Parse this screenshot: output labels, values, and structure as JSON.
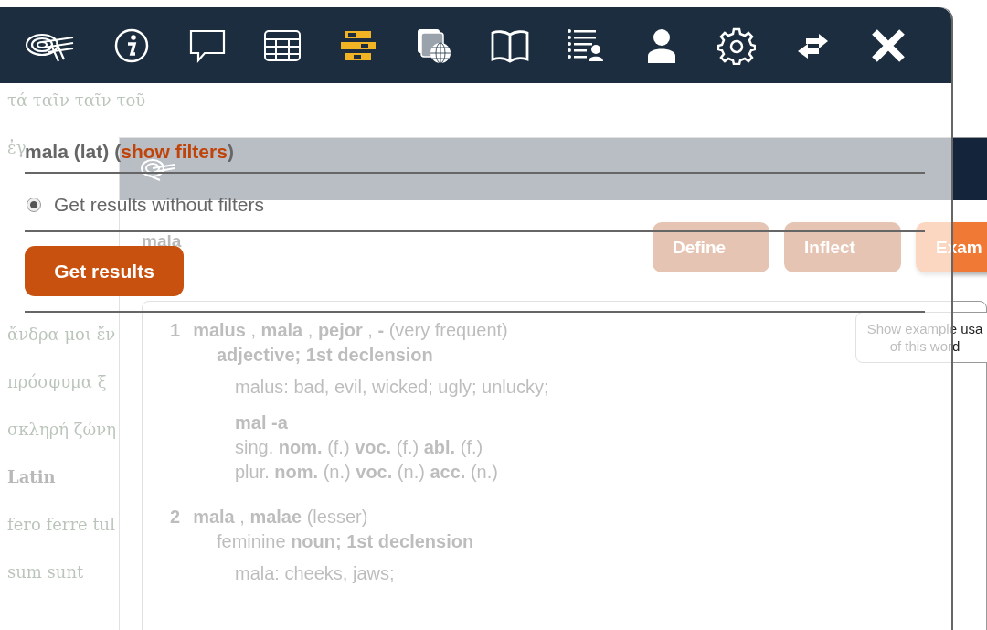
{
  "background": {
    "text_blocks": [
      [
        {
          "kind": "line",
          "text": "τά ταῖν ταῖν τοῦ"
        },
        {
          "kind": "line",
          "text": "ἐγ"
        }
      ],
      [
        {
          "kind": "line",
          "text": "ἄνδρα μοι ἔν"
        },
        {
          "kind": "line",
          "text": "πρόσφυμα ξ"
        },
        {
          "kind": "line",
          "text": "σκληρή ζώνη"
        },
        {
          "kind": "heading",
          "text": "Latin"
        },
        {
          "kind": "line",
          "text": "fero ferre tul"
        },
        {
          "kind": "line",
          "text": "sum sunt"
        }
      ]
    ],
    "popup": {
      "word": "mala",
      "buttons": [
        {
          "label": "Define",
          "selected": false
        },
        {
          "label": "Inflect",
          "selected": false
        },
        {
          "label": "Exam",
          "selected": true
        }
      ],
      "tooltip": [
        "Show example usa",
        "of this word"
      ],
      "entries": [
        {
          "number": "1",
          "headword": "**malus** , **mala** , **pejor** , **-** (very frequent)",
          "lines": [
            {
              "kind": "pos",
              "text": "**adjective; 1st declension**"
            },
            {
              "kind": "meaning",
              "text": "malus: bad, evil, wicked; ugly; unlucky;"
            },
            {
              "kind": "stem",
              "text": "mal -a"
            },
            {
              "kind": "form",
              "text": "sing. **nom.** (f.) **voc.** (f.) **abl.** (f.)"
            },
            {
              "kind": "form",
              "text": "plur. **nom.** (n.) **voc.** (n.) **acc.** (n.)"
            }
          ]
        },
        {
          "number": "2",
          "headword": "**mala** , **malae** (lesser)",
          "lines": [
            {
              "kind": "pos",
              "text": "feminine **noun; 1st declension**"
            },
            {
              "kind": "meaning",
              "text": "mala: cheeks, jaws;"
            }
          ]
        }
      ]
    }
  },
  "toolbar": {
    "tools": [
      {
        "kind": "logo",
        "selected": false
      },
      {
        "kind": "info",
        "selected": false
      },
      {
        "kind": "chat",
        "selected": false
      },
      {
        "kind": "table",
        "selected": false
      },
      {
        "kind": "bars",
        "selected": true
      },
      {
        "kind": "globe",
        "selected": false
      },
      {
        "kind": "book",
        "selected": false
      },
      {
        "kind": "list",
        "selected": false
      },
      {
        "kind": "user",
        "selected": false
      },
      {
        "kind": "gear",
        "selected": false
      },
      {
        "kind": "swap",
        "selected": false
      },
      {
        "kind": "close",
        "selected": false
      }
    ]
  },
  "panel": {
    "query": "mala (lat)",
    "filter_prefix": "(",
    "filters_link": "show filters",
    "filter_suffix": ")",
    "options": [
      {
        "label": "Get results without filters",
        "selected": true
      }
    ],
    "submit": "Get results"
  }
}
